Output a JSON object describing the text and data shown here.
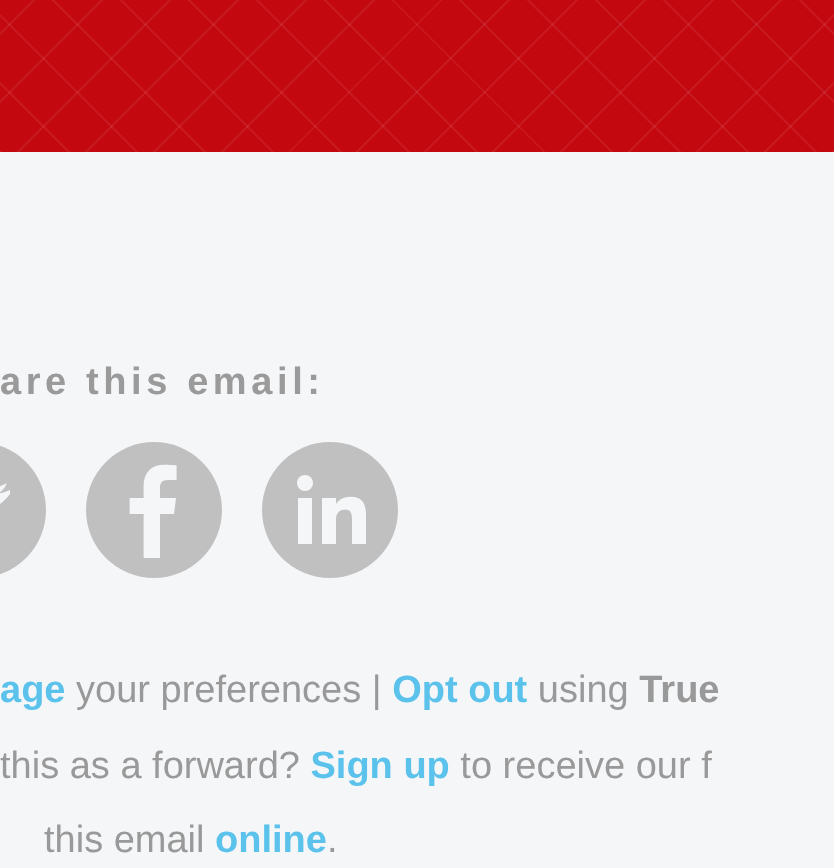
{
  "share": {
    "heading": "are this email:",
    "icons": [
      {
        "kind": "twitter"
      },
      {
        "kind": "facebook"
      },
      {
        "kind": "linkedin"
      }
    ]
  },
  "footer_lines": [
    [
      {
        "kind": "link",
        "text": "age"
      },
      {
        "kind": "text",
        "text": " your preferences | "
      },
      {
        "kind": "link",
        "text": "Opt out"
      },
      {
        "kind": "text",
        "text": " using "
      },
      {
        "kind": "bold",
        "text": "True"
      }
    ],
    [
      {
        "kind": "text",
        "text": "this as a forward? "
      },
      {
        "kind": "link",
        "text": "Sign up"
      },
      {
        "kind": "text",
        "text": " to receive our f"
      }
    ],
    [
      {
        "kind": "text",
        "text": "this email "
      },
      {
        "kind": "link",
        "text": "online"
      },
      {
        "kind": "text",
        "text": "."
      }
    ]
  ]
}
